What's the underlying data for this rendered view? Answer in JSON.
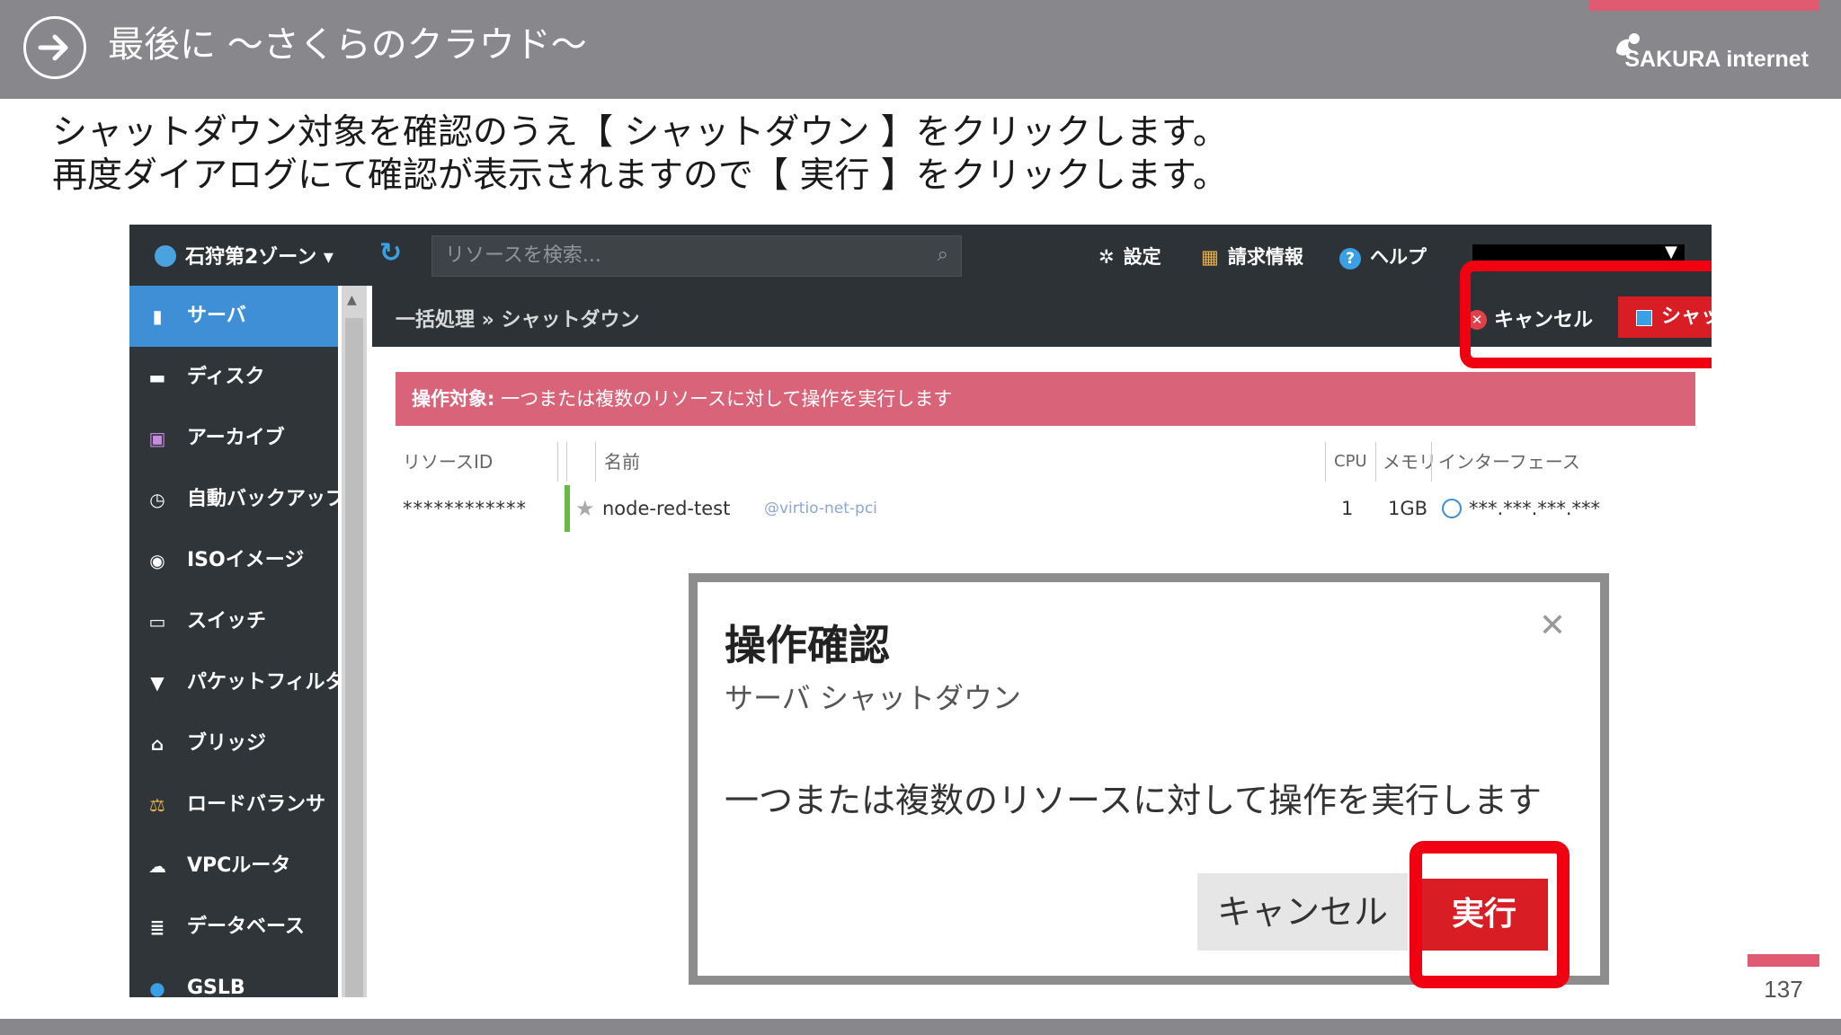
{
  "slide": {
    "title": "最後に ～さくらのクラウド～",
    "brand": "SAKURA internet",
    "instructions": [
      "シャットダウン対象を確認のうえ【 シャットダウン 】をクリックします。",
      "再度ダイアログにて確認が表示されますので【 実行 】をクリックします。"
    ],
    "page_number": "137"
  },
  "topbar": {
    "zone": "石狩第2ゾーン",
    "refresh_icon": "refresh-icon",
    "search_placeholder": "リソースを検索...",
    "nav": [
      {
        "label": "設定",
        "icon": "gear-icon"
      },
      {
        "label": "請求情報",
        "icon": "billing-icon"
      },
      {
        "label": "ヘルプ",
        "icon": "help-icon"
      }
    ]
  },
  "sidebar": {
    "items": [
      {
        "label": "サーバ",
        "icon": "server-icon",
        "active": true
      },
      {
        "label": "ディスク",
        "icon": "disk-icon"
      },
      {
        "label": "アーカイブ",
        "icon": "archive-icon"
      },
      {
        "label": "自動バックアップ",
        "icon": "clock-icon"
      },
      {
        "label": "ISOイメージ",
        "icon": "disc-icon"
      },
      {
        "label": "スイッチ",
        "icon": "switch-icon"
      },
      {
        "label": "パケットフィルタ",
        "icon": "filter-icon"
      },
      {
        "label": "ブリッジ",
        "icon": "bridge-icon"
      },
      {
        "label": "ロードバランサ",
        "icon": "balance-icon"
      },
      {
        "label": "VPCルータ",
        "icon": "cloud-icon"
      },
      {
        "label": "データベース",
        "icon": "database-icon"
      },
      {
        "label": "GSLB",
        "icon": "gslb-icon"
      }
    ]
  },
  "toolbar": {
    "breadcrumb": "一括処理 » シャットダウン",
    "cancel_label": "キャンセル",
    "shutdown_label": "シャットダウン"
  },
  "alert": {
    "label": "操作対象:",
    "text": "一つまたは複数のリソースに対して操作を実行します"
  },
  "table": {
    "headers": {
      "id": "リソースID",
      "name": "名前",
      "cpu": "CPU",
      "memory": "メモリ",
      "interface": "インターフェース"
    },
    "rows": [
      {
        "id": "************",
        "name": "node-red-test",
        "driver": "@virtio-net-pci",
        "cpu": "1",
        "memory": "1GB",
        "interface": "***.***.***.***"
      }
    ]
  },
  "dialog": {
    "title": "操作確認",
    "subtitle": "サーバ シャットダウン",
    "message": "一つまたは複数のリソースに対して操作を実行します",
    "cancel_label": "キャンセル",
    "execute_label": "実行"
  },
  "colors": {
    "header_gray": "#87878c",
    "accent_pink": "#e05a72",
    "highlight_red": "#f00010",
    "button_red": "#d81d24",
    "sidebar_active": "#3e8fd6"
  }
}
